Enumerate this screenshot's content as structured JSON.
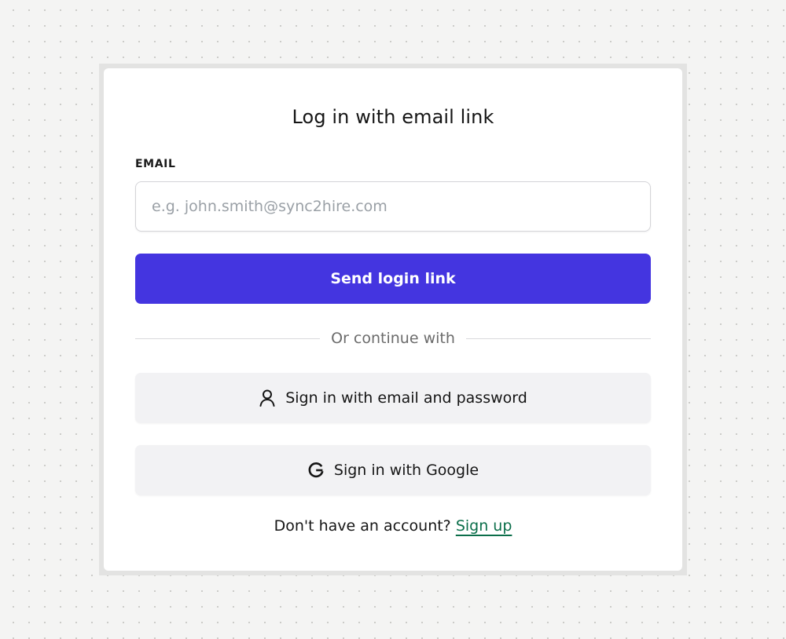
{
  "login": {
    "title": "Log in with email link",
    "email_label": "EMAIL",
    "email_value": "",
    "email_placeholder": "e.g. john.smith@sync2hire.com",
    "send_button_label": "Send login link",
    "divider_text": "Or continue with",
    "password_button": {
      "label": "Sign in with email and password",
      "icon": "user-icon"
    },
    "google_button": {
      "label": "Sign in with Google",
      "icon": "google-icon"
    },
    "signup_prompt": "Don't have an account?",
    "signup_link_label": "Sign up"
  },
  "colors": {
    "primary": "#4435e0",
    "link": "#0b6e4a",
    "secondary_button_bg": "#f2f2f4"
  }
}
